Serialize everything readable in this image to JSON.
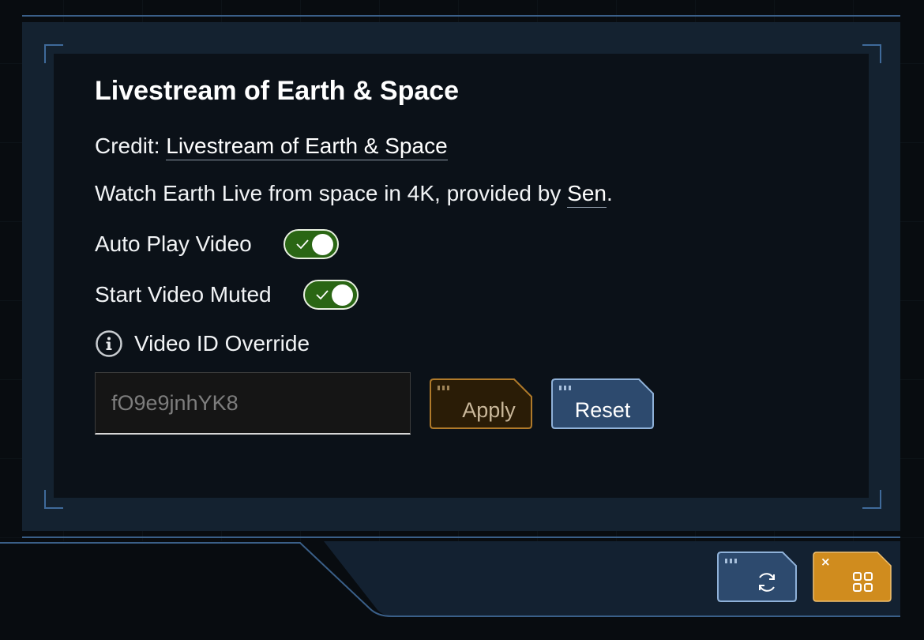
{
  "panel": {
    "title": "Livestream of Earth & Space",
    "credit_prefix": "Credit: ",
    "credit_link": "Livestream of Earth & Space",
    "description_prefix": "Watch Earth Live from space in 4K, provided by ",
    "description_link": "Sen",
    "description_suffix": "."
  },
  "settings": {
    "autoplay": {
      "label": "Auto Play Video",
      "on": true
    },
    "muted": {
      "label": "Start Video Muted",
      "on": true
    }
  },
  "override": {
    "label": "Video ID Override",
    "placeholder": "fO9e9jnhYK8",
    "value": "",
    "apply_label": "Apply",
    "reset_label": "Reset"
  },
  "bottom_bar": {
    "refresh_icon": "refresh-icon",
    "grid_icon": "grid-icon",
    "close_mark": "×"
  },
  "colors": {
    "toggle_on": "#2a6614",
    "apply_border": "#b07a2a",
    "reset_fill": "#2d4a6e",
    "accent_gold": "#d08c1e"
  }
}
